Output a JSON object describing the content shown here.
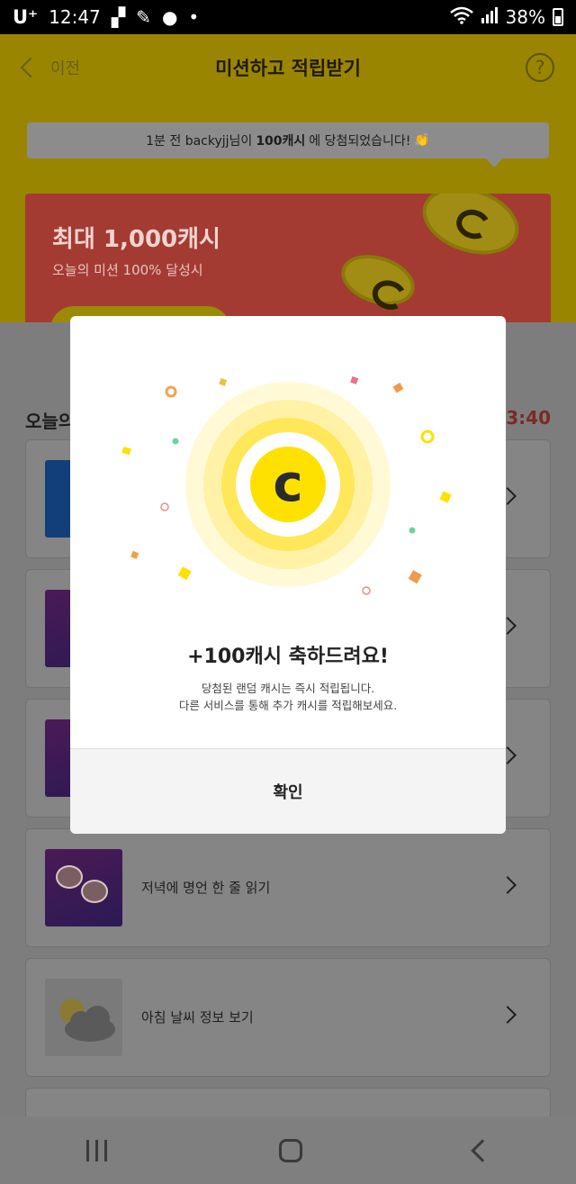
{
  "status_bar": {
    "carrier": "U⁺",
    "time": "12:47",
    "battery": "38%",
    "icons": [
      "wifi-icon",
      "signal-icon",
      "battery-icon"
    ]
  },
  "header": {
    "back_label": "이전",
    "title": "미션하고 적립받기",
    "help_icon": "?"
  },
  "ticker": {
    "prefix": "1분 전 backyjj님이",
    "amount": "100캐시",
    "suffix": "에 당첨되었습니다!",
    "emoji": "👏"
  },
  "banner": {
    "title": "최대 1,000캐시",
    "subtitle": "오늘의 미션 100% 달성시"
  },
  "missions": {
    "section_title": "오늘의",
    "timer": "3:40",
    "items": [
      {
        "label": "",
        "thumb": "puzzle"
      },
      {
        "label": "",
        "thumb": "purple"
      },
      {
        "label": "",
        "thumb": "purple"
      },
      {
        "label": "저녁에 명언 한 줄 읽기",
        "thumb": "purple"
      },
      {
        "label": "아침 날씨 정보 보기",
        "thumb": "weather"
      }
    ]
  },
  "modal": {
    "coin_letter": "c",
    "title": "+100캐시 축하드려요!",
    "desc_line1": "당첨된 랜덤 캐시는 즉시 적립됩니다.",
    "desc_line2": "다른 서비스를 통해 추가 캐시를 적립해보세요.",
    "confirm_label": "확인"
  },
  "colors": {
    "accent_yellow": "#ffe100",
    "banner_red": "#e8574d",
    "coin_ring": "#fff06a"
  }
}
